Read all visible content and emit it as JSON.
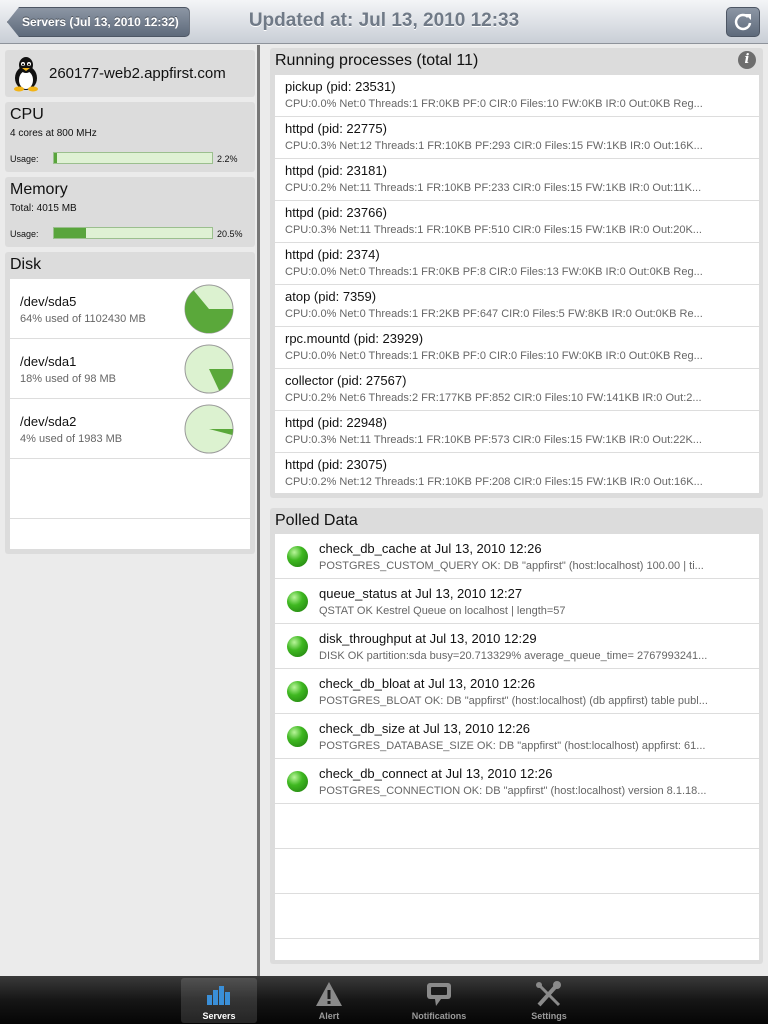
{
  "nav": {
    "back_label": "Servers (Jul 13, 2010 12:32)",
    "title": "Updated at: Jul 13, 2010 12:33"
  },
  "server": {
    "name": "260177-web2.appfirst.com"
  },
  "cpu": {
    "title": "CPU",
    "detail": "4 cores at 800 MHz",
    "usage_label": "Usage:",
    "usage_pct": "2.2%",
    "usage_fraction": 0.022
  },
  "memory": {
    "title": "Memory",
    "detail": "Total: 4015 MB",
    "usage_label": "Usage:",
    "usage_pct": "20.5%",
    "usage_fraction": 0.205
  },
  "disk": {
    "title": "Disk",
    "items": [
      {
        "name": "/dev/sda5",
        "usage": "64% used of 1102430 MB",
        "fraction": 0.64
      },
      {
        "name": "/dev/sda1",
        "usage": "18% used of 98 MB",
        "fraction": 0.18
      },
      {
        "name": "/dev/sda2",
        "usage": "4% used of 1983 MB",
        "fraction": 0.04
      }
    ]
  },
  "processes": {
    "title": "Running processes (total 11)",
    "items": [
      {
        "name": "pickup (pid: 23531)",
        "stats": "CPU:0.0% Net:0 Threads:1 FR:0KB PF:0 CIR:0 Files:10 FW:0KB IR:0 Out:0KB Reg..."
      },
      {
        "name": "httpd (pid: 22775)",
        "stats": "CPU:0.3% Net:12 Threads:1 FR:10KB PF:293 CIR:0 Files:15 FW:1KB IR:0 Out:16K..."
      },
      {
        "name": "httpd (pid: 23181)",
        "stats": "CPU:0.2% Net:11 Threads:1 FR:10KB PF:233 CIR:0 Files:15 FW:1KB IR:0 Out:11K..."
      },
      {
        "name": "httpd (pid: 23766)",
        "stats": "CPU:0.3% Net:11 Threads:1 FR:10KB PF:510 CIR:0 Files:15 FW:1KB IR:0 Out:20K..."
      },
      {
        "name": "httpd (pid: 2374)",
        "stats": "CPU:0.0% Net:0 Threads:1 FR:0KB PF:8 CIR:0 Files:13 FW:0KB IR:0 Out:0KB Reg..."
      },
      {
        "name": "atop (pid: 7359)",
        "stats": "CPU:0.0% Net:0 Threads:1 FR:2KB PF:647 CIR:0 Files:5 FW:8KB IR:0 Out:0KB Re..."
      },
      {
        "name": "rpc.mountd (pid: 23929)",
        "stats": "CPU:0.0% Net:0 Threads:1 FR:0KB PF:0 CIR:0 Files:10 FW:0KB IR:0 Out:0KB Reg..."
      },
      {
        "name": "collector (pid: 27567)",
        "stats": "CPU:0.2% Net:6 Threads:2 FR:177KB PF:852 CIR:0 Files:10 FW:141KB IR:0 Out:2..."
      },
      {
        "name": "httpd (pid: 22948)",
        "stats": "CPU:0.3% Net:11 Threads:1 FR:10KB PF:573 CIR:0 Files:15 FW:1KB IR:0 Out:22K..."
      },
      {
        "name": "httpd (pid: 23075)",
        "stats": "CPU:0.2% Net:12 Threads:1 FR:10KB PF:208 CIR:0 Files:15 FW:1KB IR:0 Out:16K..."
      }
    ]
  },
  "polled": {
    "title": "Polled Data",
    "items": [
      {
        "name": "check_db_cache at Jul 13, 2010 12:26",
        "message": "POSTGRES_CUSTOM_QUERY OK: DB \"appfirst\" (host:localhost) 100.00 | ti..."
      },
      {
        "name": "queue_status at Jul 13, 2010 12:27",
        "message": "QSTAT OK Kestrel Queue on localhost | length=57"
      },
      {
        "name": "disk_throughput at Jul 13, 2010 12:29",
        "message": "DISK OK partition:sda busy=20.713329% average_queue_time= 2767993241..."
      },
      {
        "name": "check_db_bloat at Jul 13, 2010 12:26",
        "message": "POSTGRES_BLOAT OK: DB \"appfirst\" (host:localhost) (db appfirst) table publ..."
      },
      {
        "name": "check_db_size at Jul 13, 2010 12:26",
        "message": "POSTGRES_DATABASE_SIZE OK: DB \"appfirst\" (host:localhost) appfirst: 61..."
      },
      {
        "name": "check_db_connect at Jul 13, 2010 12:26",
        "message": "POSTGRES_CONNECTION OK: DB \"appfirst\" (host:localhost) version 8.1.18..."
      }
    ]
  },
  "tabs": [
    {
      "label": "Servers",
      "icon": "bar-chart-icon",
      "active": true
    },
    {
      "label": "Alert",
      "icon": "warning-icon",
      "active": false
    },
    {
      "label": "Notifications",
      "icon": "speech-bubble-icon",
      "active": false
    },
    {
      "label": "Settings",
      "icon": "tools-icon",
      "active": false
    }
  ],
  "colors": {
    "usage_fill": "#59a53c",
    "usage_track": "#dff1d4",
    "pie_used": "#5aa83a",
    "pie_free": "#dcf2d0"
  }
}
